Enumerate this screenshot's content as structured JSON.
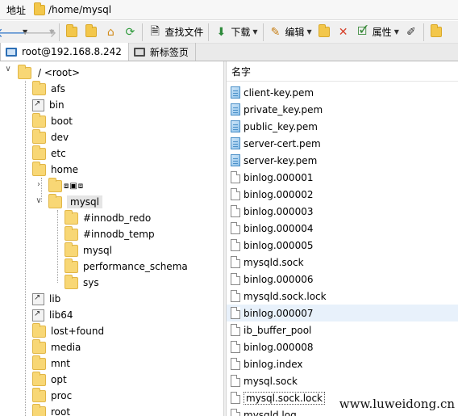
{
  "address": {
    "label": "地址",
    "path": "/home/mysql"
  },
  "toolbar": {
    "find_file": "查找文件",
    "download": "下载",
    "edit": "编辑",
    "properties": "属性"
  },
  "tabs": [
    {
      "label": "root@192.168.8.242",
      "active": true
    },
    {
      "label": "新标签页",
      "active": false
    }
  ],
  "tree": {
    "root_label": "/ <root>",
    "items": {
      "afs": "afs",
      "bin": "bin",
      "boot": "boot",
      "dev": "dev",
      "etc": "etc",
      "home": "home",
      "mysql": "mysql",
      "innodb_redo": "#innodb_redo",
      "innodb_temp": "#innodb_temp",
      "mysql_sub": "mysql",
      "performance_schema": "performance_schema",
      "sys": "sys",
      "lib": "lib",
      "lib64": "lib64",
      "lost_found": "lost+found",
      "media": "media",
      "mnt": "mnt",
      "opt": "opt",
      "proc": "proc",
      "root": "root"
    }
  },
  "file_list": {
    "column_name": "名字",
    "files": [
      {
        "name": "client-key.pem",
        "type": "pem"
      },
      {
        "name": "private_key.pem",
        "type": "pem"
      },
      {
        "name": "public_key.pem",
        "type": "pem"
      },
      {
        "name": "server-cert.pem",
        "type": "pem"
      },
      {
        "name": "server-key.pem",
        "type": "pem"
      },
      {
        "name": "binlog.000001",
        "type": "file"
      },
      {
        "name": "binlog.000002",
        "type": "file"
      },
      {
        "name": "binlog.000003",
        "type": "file"
      },
      {
        "name": "binlog.000004",
        "type": "file"
      },
      {
        "name": "binlog.000005",
        "type": "file"
      },
      {
        "name": "mysqld.sock",
        "type": "file"
      },
      {
        "name": "binlog.000006",
        "type": "file"
      },
      {
        "name": "mysqld.sock.lock",
        "type": "file"
      },
      {
        "name": "binlog.000007",
        "type": "file",
        "highlighted": true
      },
      {
        "name": "ib_buffer_pool",
        "type": "file"
      },
      {
        "name": "binlog.000008",
        "type": "file"
      },
      {
        "name": "binlog.index",
        "type": "file"
      },
      {
        "name": "mysql.sock",
        "type": "file"
      },
      {
        "name": "mysql.sock.lock",
        "type": "file",
        "focused": true
      },
      {
        "name": "mysqld.log",
        "type": "file"
      }
    ]
  },
  "watermark": "www.luweidong.cn",
  "colors": {
    "folder": "#f8d775",
    "accent": "#2d6fb5",
    "highlight_row": "#e8f1fb"
  }
}
